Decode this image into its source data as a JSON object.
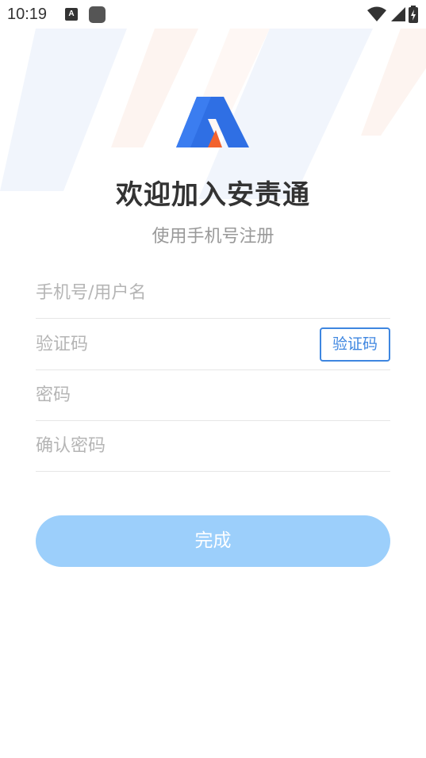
{
  "status_bar": {
    "time": "10:19",
    "notification_badge": "A"
  },
  "header": {
    "title": "欢迎加入安责通",
    "subtitle": "使用手机号注册"
  },
  "form": {
    "phone_placeholder": "手机号/用户名",
    "code_placeholder": "验证码",
    "code_button_label": "验证码",
    "password_placeholder": "密码",
    "confirm_password_placeholder": "确认密码",
    "submit_label": "完成"
  },
  "colors": {
    "accent": "#3e86e0",
    "submit_bg": "#9ccffb",
    "logo_blue": "#2f6fe4",
    "logo_orange": "#f2622e"
  }
}
